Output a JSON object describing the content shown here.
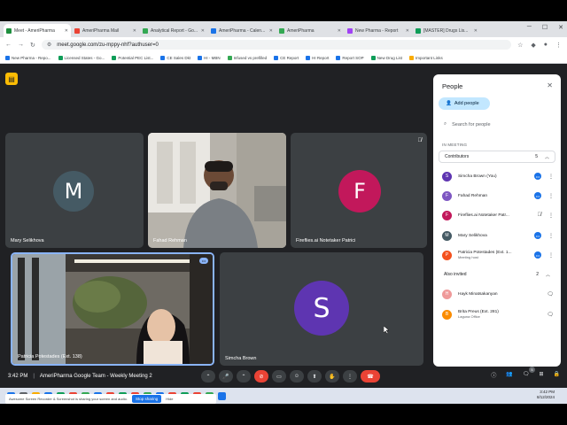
{
  "browser": {
    "tabs": [
      {
        "label": "Meet - AmeriPharma",
        "color": "#1e8e3e",
        "active": true
      },
      {
        "label": "AmeriPharma Mail",
        "color": "#ea4335"
      },
      {
        "label": "Analytical Report - Go...",
        "color": "#34a853"
      },
      {
        "label": "AmeriPharma - Calen...",
        "color": "#1a73e8"
      },
      {
        "label": "AmeriPharma",
        "color": "#34a853"
      },
      {
        "label": "New Pharma - Report",
        "color": "#a142f4"
      },
      {
        "label": "[MASTER] Drugs Lis...",
        "color": "#0f9d58"
      }
    ],
    "url": "meet.google.com/zu-mppy-nhf?authuser=0",
    "bookmarks": [
      {
        "label": "New Pharma - Repo...",
        "color": "#1a73e8"
      },
      {
        "label": "Licensed States - Go...",
        "color": "#0f9d58"
      },
      {
        "label": "Potential PEC List...",
        "color": "#0f9d58"
      },
      {
        "label": "CE Sales Dkt",
        "color": "#1a73e8"
      },
      {
        "label": "HI - MBN",
        "color": "#1a73e8"
      },
      {
        "label": "Infused vs prefilled",
        "color": "#34a853"
      },
      {
        "label": "CE Report",
        "color": "#1a73e8"
      },
      {
        "label": "HI Report",
        "color": "#1a73e8"
      },
      {
        "label": "Report SOP",
        "color": "#1a73e8"
      },
      {
        "label": "New Drug List",
        "color": "#0f9d58"
      },
      {
        "label": "Important Links",
        "color": "#f9ab00"
      }
    ]
  },
  "tiles": {
    "t1": {
      "initial": "M",
      "name": "Mary Selikhova",
      "color": "#455a64"
    },
    "t2": {
      "name": "Fahad Rehman"
    },
    "t3": {
      "initial": "F",
      "name": "Fireflies.ai Notetaker Patrici",
      "color": "#c2185b"
    },
    "t4": {
      "name": "Patricia Potestades (Ext. 138)"
    },
    "t5": {
      "initial": "S",
      "name": "Simcha Brown",
      "color": "#5e35b1"
    }
  },
  "bottom": {
    "time": "3:42 PM",
    "separator": "|",
    "meeting": "AmeriPharma Google Team - Weekly Meeting 2",
    "badge": "5"
  },
  "panel": {
    "title": "People",
    "add": "Add people",
    "search_placeholder": "Search for people",
    "in_meeting": "IN MEETING",
    "contributors": "Contributors",
    "contributors_count": "5",
    "people": [
      {
        "initial": "S",
        "name": "Simcha Brown (You)",
        "color": "#5e35b1",
        "sub": ""
      },
      {
        "initial": "F",
        "name": "Fahad Rehman",
        "color": "#7e57c2",
        "sub": ""
      },
      {
        "initial": "F",
        "name": "Fireflies.ai Notetaker Patr...",
        "color": "#c2185b",
        "sub": ""
      },
      {
        "initial": "M",
        "name": "Mary Selikhova",
        "color": "#455a64",
        "sub": ""
      },
      {
        "initial": "P",
        "name": "Patricia Potestades (Ext. 1...",
        "color": "#f4511e",
        "sub": "Meeting host"
      }
    ],
    "also_invited": "Also invited",
    "also_count": "2",
    "invited": [
      {
        "initial": "H",
        "name": "Hayk Minatsakanyan",
        "color": "#ef9a9a",
        "sub": ""
      },
      {
        "initial": "B",
        "name": "Brita Preus (Ext. 281)",
        "color": "#fb8c00",
        "sub": "Laguna Office"
      }
    ]
  },
  "notice": {
    "text": "Awesome Screen Recorder & Screenshot is sharing your screen and audio.",
    "stop": "Stop sharing",
    "hide": "Hide"
  },
  "taskbar": {
    "time": "3:42 PM",
    "date": "8/12/2024",
    "icons": [
      "#1a73e8",
      "#5f6368",
      "#f9ab00",
      "#1a73e8",
      "#0f9d58",
      "#ea4335",
      "#34a853",
      "#1a73e8",
      "#ea4335",
      "#0f9d58",
      "#ea4335",
      "#34a853",
      "#1a73e8",
      "#ea4335",
      "#0f9d58",
      "#ea4335",
      "#34a853",
      "#1a73e8",
      "#ea4335",
      "#0f9d58",
      "#34a853"
    ]
  }
}
